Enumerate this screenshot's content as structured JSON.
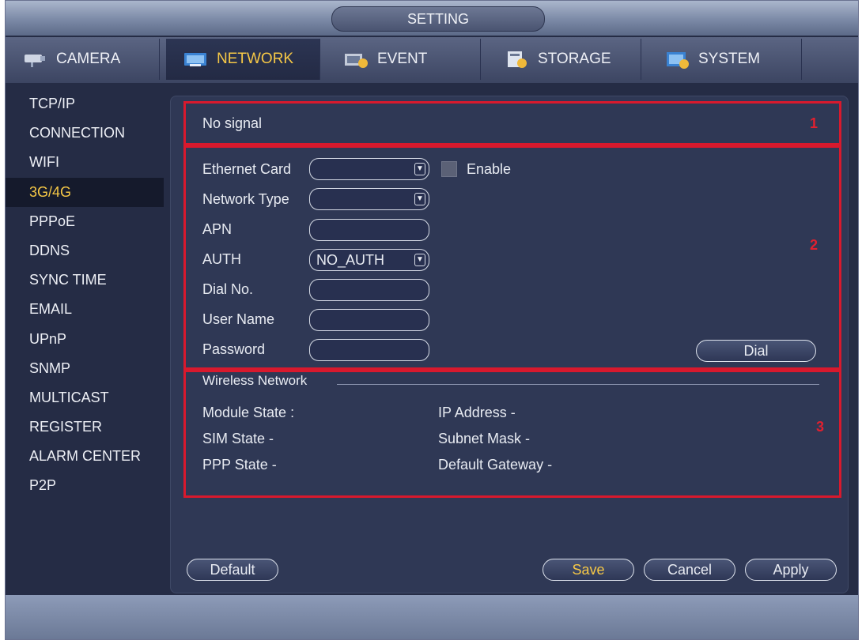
{
  "window": {
    "title": "SETTING"
  },
  "tabs": [
    {
      "label": "CAMERA",
      "icon": "camera-icon"
    },
    {
      "label": "NETWORK",
      "icon": "network-icon"
    },
    {
      "label": "EVENT",
      "icon": "event-icon"
    },
    {
      "label": "STORAGE",
      "icon": "storage-icon"
    },
    {
      "label": "SYSTEM",
      "icon": "system-icon"
    }
  ],
  "sidebar": {
    "items": [
      {
        "label": "TCP/IP"
      },
      {
        "label": "CONNECTION"
      },
      {
        "label": "WIFI"
      },
      {
        "label": "3G/4G"
      },
      {
        "label": "PPPoE"
      },
      {
        "label": "DDNS"
      },
      {
        "label": "SYNC TIME"
      },
      {
        "label": "EMAIL"
      },
      {
        "label": "UPnP"
      },
      {
        "label": "SNMP"
      },
      {
        "label": "MULTICAST"
      },
      {
        "label": "REGISTER"
      },
      {
        "label": "ALARM CENTER"
      },
      {
        "label": "P2P"
      }
    ]
  },
  "signal": {
    "status": "No signal"
  },
  "form": {
    "ethernet_card_label": "Ethernet Card",
    "ethernet_card_value": "",
    "enable_label": "Enable",
    "network_type_label": "Network Type",
    "network_type_value": "",
    "apn_label": "APN",
    "apn_value": "",
    "auth_label": "AUTH",
    "auth_value": "NO_AUTH",
    "dial_no_label": "Dial No.",
    "dial_no_value": "",
    "user_name_label": "User Name",
    "user_name_value": "",
    "password_label": "Password",
    "password_value": "",
    "dial_button": "Dial"
  },
  "wireless": {
    "title": "Wireless Network",
    "module_state": "Module State :",
    "sim_state": "SIM State -",
    "ppp_state": "PPP State -",
    "ip_address": "IP Address -",
    "subnet_mask": "Subnet Mask -",
    "default_gateway": "Default Gateway -"
  },
  "annotations": {
    "box1": "1",
    "box2": "2",
    "box3": "3"
  },
  "buttons": {
    "default": "Default",
    "save": "Save",
    "cancel": "Cancel",
    "apply": "Apply"
  },
  "colors": {
    "highlight": "#f6c846",
    "annotation_red": "#d8192d",
    "panel": "#2f3855"
  }
}
